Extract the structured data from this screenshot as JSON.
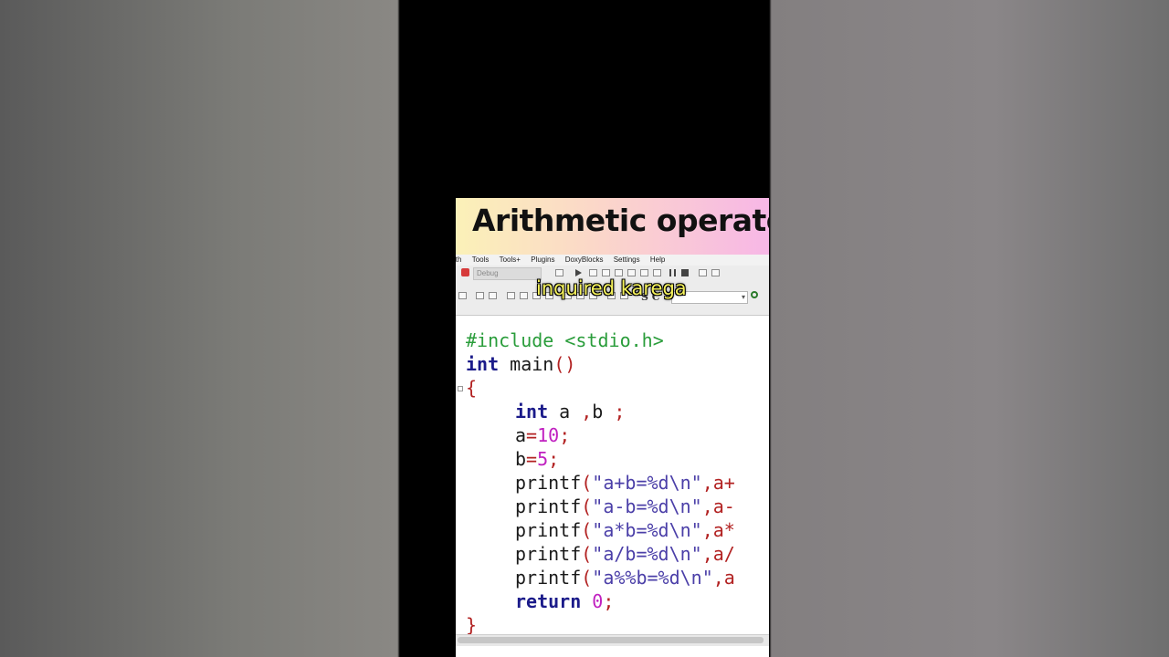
{
  "banner": {
    "title": "Arithmetic operato"
  },
  "menu": [
    "ith",
    "Tools",
    "Tools+",
    "Plugins",
    "DoxyBlocks",
    "Settings",
    "Help"
  ],
  "toolbar": {
    "build_target": "Debug",
    "sc_label": "S C"
  },
  "caption": "inquired karega",
  "code": {
    "line1": "#include <stdio.h>",
    "l2_kw": "int",
    "l2_rest": " main",
    "l2_paren": "()",
    "l3": "{",
    "l4_kw": "int",
    "l4_rest": " a ",
    "l4_p1": ",",
    "l4_rest2": "b ",
    "l4_p2": ";",
    "l5_a": "a",
    "l5_eq": "=",
    "l5_num": "10",
    "l5_semi": ";",
    "l6_b": "b",
    "l6_eq": "=",
    "l6_num": "5",
    "l6_semi": ";",
    "l7_fn": "printf",
    "l7_p": "(",
    "l7_str": "\"a+b=%d\\n\"",
    "l7_rest": ",a+",
    "l8_fn": "printf",
    "l8_p": "(",
    "l8_str": "\"a-b=%d\\n\"",
    "l8_rest": ",a-",
    "l9_fn": "printf",
    "l9_p": "(",
    "l9_str": "\"a*b=%d\\n\"",
    "l9_rest": ",a*",
    "l10_fn": "printf",
    "l10_p": "(",
    "l10_str": "\"a/b=%d\\n\"",
    "l10_rest": ",a/",
    "l11_fn": "printf",
    "l11_p": "(",
    "l11_str": "\"a%%b=%d\\n\"",
    "l11_rest": ",a",
    "l12_kw": "return",
    "l12_num": " 0",
    "l12_semi": ";",
    "l13": "}"
  }
}
